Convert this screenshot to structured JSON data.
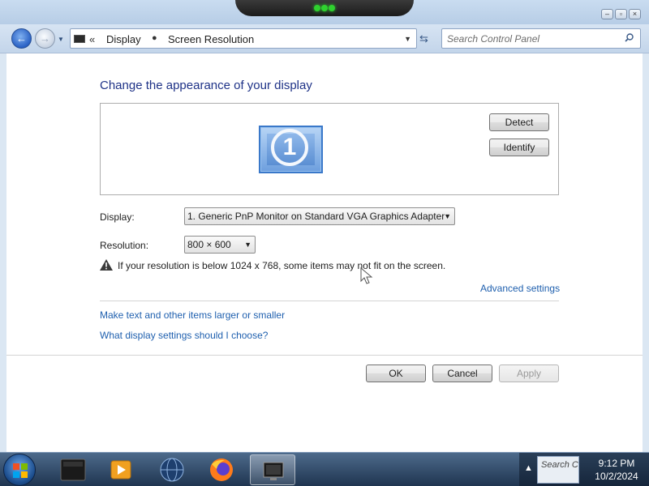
{
  "window": {
    "controls": [
      "minimize",
      "maximize",
      "close"
    ]
  },
  "nav": {
    "breadcrumb": [
      "Display",
      "Screen Resolution"
    ],
    "search_placeholder": "Search Control Panel"
  },
  "main": {
    "heading": "Change the appearance of your display",
    "monitor_number": "1",
    "detect_label": "Detect",
    "identify_label": "Identify",
    "display_label": "Display:",
    "display_value": "1. Generic PnP Monitor on Standard VGA Graphics Adapter",
    "resolution_label": "Resolution:",
    "resolution_value": "800 × 600",
    "warning_text": "If your resolution is below 1024 x 768, some items may not fit on the screen.",
    "advanced_link": "Advanced settings",
    "link_text_size": "Make text and other items larger or smaller",
    "link_help": "What display settings should I choose?"
  },
  "footer": {
    "ok_label": "OK",
    "cancel_label": "Cancel",
    "apply_label": "Apply"
  },
  "taskbar": {
    "tray_search_preview": "Search Co",
    "time": "9:12 PM",
    "date": "10/2/2024"
  }
}
